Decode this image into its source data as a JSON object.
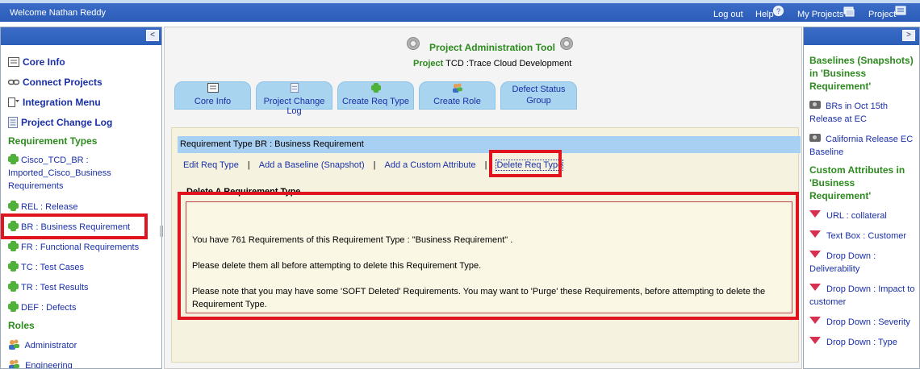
{
  "topbar": {
    "welcome": "Welcome Nathan Reddy",
    "logout": "Log out",
    "help": "Help",
    "my_projects": "My Projects",
    "project": "Project"
  },
  "left_nav": {
    "collapse": "<",
    "items": [
      {
        "label": "Core Info",
        "icon": "core-info-icon"
      },
      {
        "label": "Connect Projects",
        "icon": "chain-link-icon"
      },
      {
        "label": "Integration Menu",
        "icon": "integration-menu-icon"
      },
      {
        "label": "Project Change Log",
        "icon": "document-icon"
      }
    ],
    "req_types_heading": "Requirement Types",
    "req_types": [
      "Cisco_TCD_BR : Imported_Cisco_Business Requirements",
      "REL : Release",
      "BR : Business Requirement",
      "FR : Functional Requirements",
      "TC : Test Cases",
      "TR : Test Results",
      "DEF : Defects"
    ],
    "roles_heading": "Roles",
    "roles": [
      "Administrator",
      "Engineering"
    ]
  },
  "center": {
    "tool_title": "Project Administration Tool",
    "project_label": "Project",
    "project_name": "TCD :Trace Cloud Development",
    "tabs": [
      {
        "label": "Core Info",
        "icon": "core-info-icon"
      },
      {
        "label": "Project Change Log",
        "icon": "document-icon"
      },
      {
        "label": "Create Req Type",
        "icon": "puzzle-icon"
      },
      {
        "label": "Create Role",
        "icon": "users-icon"
      },
      {
        "label": "Defect Status Group",
        "icon": ""
      }
    ],
    "req_header": "Requirement Type BR : Business Requirement",
    "actions": [
      "Edit Req Type",
      "Add a Baseline (Snapshot)",
      "Add a Custom Attribute",
      "Delete Req Type"
    ],
    "delete_title": "Delete A Requirement Type",
    "messages": [
      "You have 761 Requirements of this Requirement Type : \"Business Requirement\" .",
      "Please delete them all before attempting to delete this Requirement Type.",
      "Please note that you may have some 'SOFT Deleted' Requirements. You may want to 'Purge' these Requirements, before attempting to delete the Requirement Type."
    ]
  },
  "right_panel": {
    "collapse": ">",
    "baselines_heading": "Baselines (Snapshots) in 'Business Requirement'",
    "baselines": [
      "BRs in Oct 15th Release at EC",
      "California Release EC Baseline"
    ],
    "attributes_heading": "Custom Attributes in 'Business Requirement'",
    "attributes": [
      "URL : collateral",
      "Text Box : Customer",
      "Drop Down : Deliverability",
      "Drop Down : Impact to customer",
      "Drop Down : Severity",
      "Drop Down : Type"
    ]
  },
  "colors": {
    "accent_blue": "#2b5cb8",
    "heading_green": "#2d8a1f",
    "highlight_red": "#e0141e",
    "tab_blue": "#a9d4f0"
  }
}
